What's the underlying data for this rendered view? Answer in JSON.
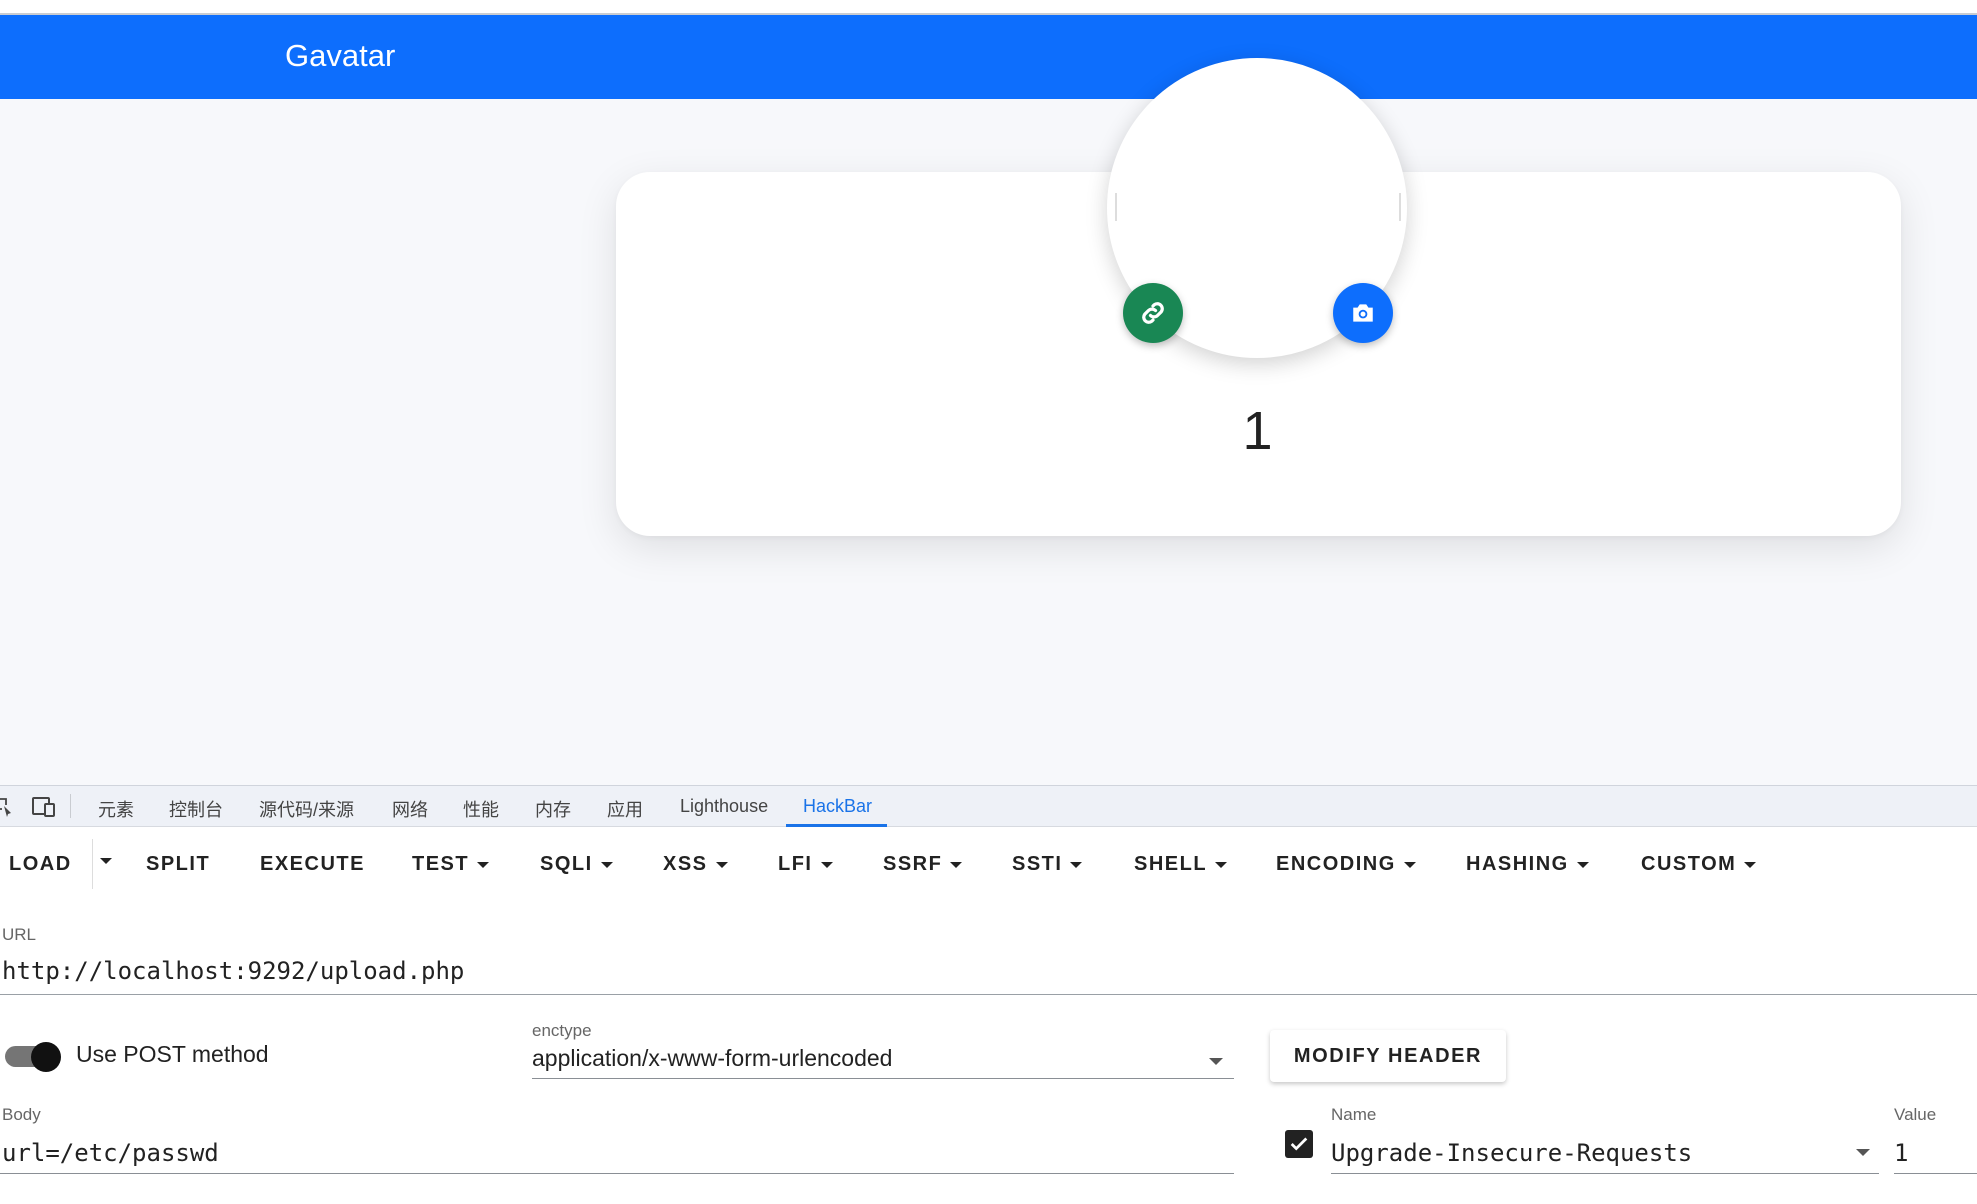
{
  "site": {
    "brand": "Gavatar"
  },
  "profile": {
    "username": "1",
    "link_icon": "link-icon",
    "camera_icon": "camera-icon"
  },
  "devtools": {
    "tabs": [
      "元素",
      "控制台",
      "源代码/来源",
      "网络",
      "性能",
      "内存",
      "应用",
      "Lighthouse",
      "HackBar"
    ],
    "active_tab": "HackBar",
    "icons": [
      "inspect-icon",
      "device-toolbar-icon"
    ]
  },
  "hackbar": {
    "toolbar": [
      "LOAD",
      "SPLIT",
      "EXECUTE",
      "TEST",
      "SQLI",
      "XSS",
      "LFI",
      "SSRF",
      "SSTI",
      "SHELL",
      "ENCODING",
      "HASHING",
      "CUSTOM"
    ],
    "url_label": "URL",
    "url": "http://localhost:9292/upload.php",
    "post_toggle_label": "Use POST method",
    "post_enabled": true,
    "enctype_label": "enctype",
    "enctype": "application/x-www-form-urlencoded",
    "modify_header_label": "MODIFY HEADER",
    "body_label": "Body",
    "body": "url=/etc/passwd",
    "header": {
      "enabled": true,
      "name_label": "Name",
      "name": "Upgrade-Insecure-Requests",
      "value_label": "Value",
      "value": "1"
    }
  },
  "colors": {
    "navbar": "#0d6efd",
    "link_button": "#198754",
    "camera_button": "#0d6efd",
    "active_tab": "#1a73e8"
  }
}
